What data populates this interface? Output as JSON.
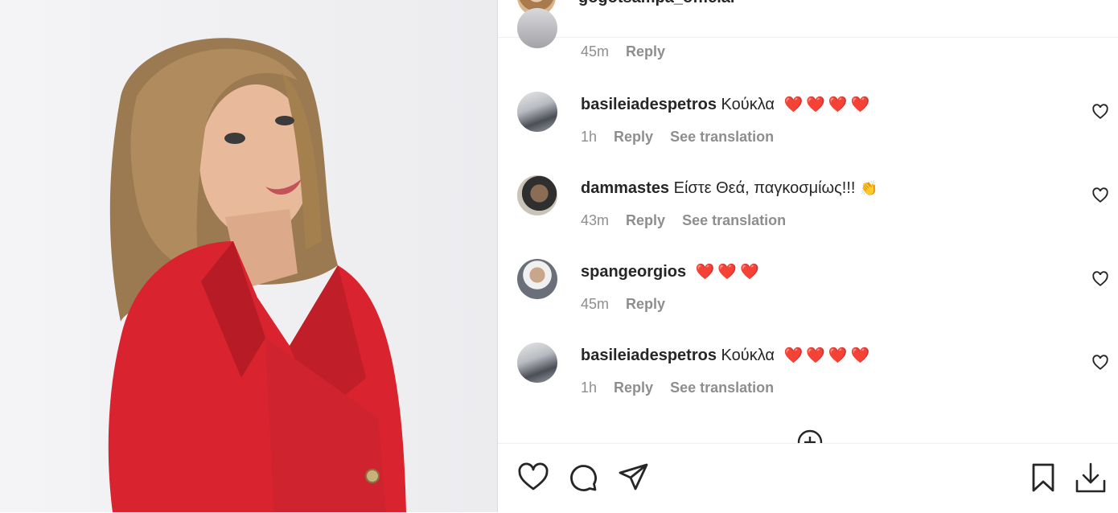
{
  "post": {
    "author": "gogotsampa_official",
    "more_label": "···"
  },
  "top_comment_partial": {
    "time": "45m",
    "reply": "Reply"
  },
  "comments": [
    {
      "username": "basileiadespetros",
      "text": "Κούκλα",
      "emoji": "❤️❤️❤️❤️",
      "time": "1h",
      "reply": "Reply",
      "translate": "See translation"
    },
    {
      "username": "dammastes",
      "text": "Είστε Θεά, παγκοσμίως!!!",
      "emoji": "👏",
      "time": "43m",
      "reply": "Reply",
      "translate": "See translation"
    },
    {
      "username": "spangeorgios",
      "text": "",
      "emoji": "❤️❤️❤️",
      "time": "45m",
      "reply": "Reply",
      "translate": ""
    },
    {
      "username": "basileiadespetros",
      "text": "Κούκλα",
      "emoji": "❤️❤️❤️❤️",
      "time": "1h",
      "reply": "Reply",
      "translate": "See translation"
    }
  ],
  "icons": {
    "comment_like": "heart-outline-icon",
    "load_more": "plus-circle-icon",
    "like": "heart-icon",
    "comment": "comment-bubble-icon",
    "share": "paper-plane-icon",
    "save": "bookmark-icon",
    "download": "download-icon"
  },
  "colors": {
    "text": "#262626",
    "secondary": "#8e8e8e",
    "heart_emoji": "#ed2f3f",
    "jacket": "#d9232f",
    "border": "#dbdbdb"
  }
}
